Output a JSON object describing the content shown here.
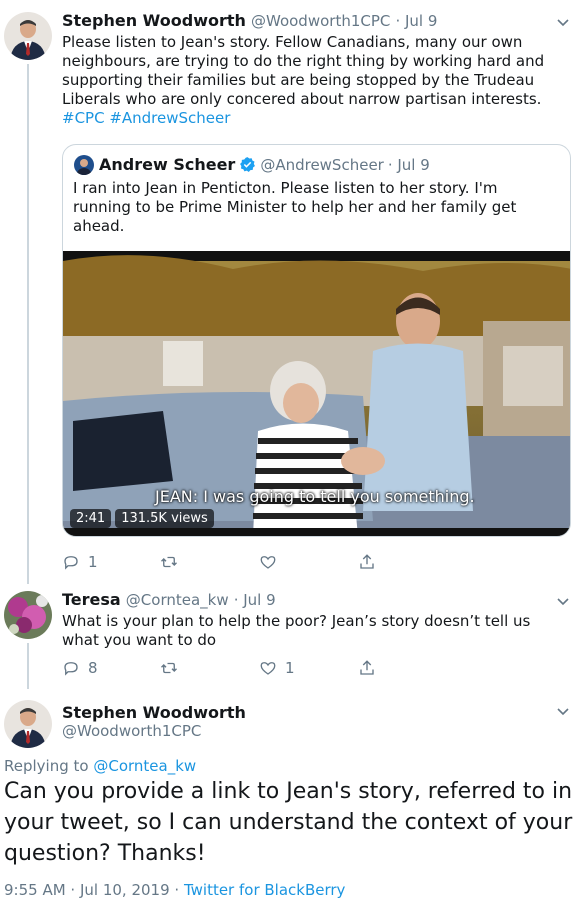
{
  "tweet1": {
    "name": "Stephen Woodworth",
    "handle": "@Woodworth1CPC",
    "date": "· Jul 9",
    "text": "Please listen to Jean's story. Fellow Canadians, many our own neighbours, are trying to do the right thing by working hard and supporting their families but are being stopped by the Trudeau Liberals who are only concered about narrow partisan interests.",
    "hashtags": "#CPC #AndrewScheer",
    "quote": {
      "name": "Andrew Scheer",
      "handle": "@AndrewScheer",
      "date": "· Jul 9",
      "text": "I ran into Jean in Penticton. Please listen to her story. I'm running to be Prime Minister to help her and her family get ahead.",
      "caption": "JEAN: I was going to tell you something.",
      "duration": "2:41",
      "views": "131.5K views"
    },
    "reply_count": "1",
    "retweet_count": "",
    "like_count": ""
  },
  "tweet2": {
    "name": "Teresa",
    "handle": "@Corntea_kw",
    "date": "· Jul 9",
    "text": "What is your plan to help the poor? Jean’s story doesn’t tell us what you want to do",
    "reply_count": "8",
    "retweet_count": "",
    "like_count": "1"
  },
  "tweet3": {
    "name": "Stephen Woodworth",
    "handle": "@Woodworth1CPC",
    "replying_prefix": "Replying to",
    "replying_to": "@Corntea_kw",
    "text": "Can you provide a link to Jean's story, referred to in your tweet, so I can understand the context of your question? Thanks!",
    "time": "9:55 AM · Jul 10, 2019 ·",
    "source": "Twitter for BlackBerry"
  },
  "colors": {
    "link": "#1b95e0",
    "muted": "#657786",
    "verified": "#1da1f2"
  },
  "icons": [
    "chevron-down-icon",
    "reply-icon",
    "retweet-icon",
    "like-icon",
    "share-icon",
    "verified-icon"
  ]
}
